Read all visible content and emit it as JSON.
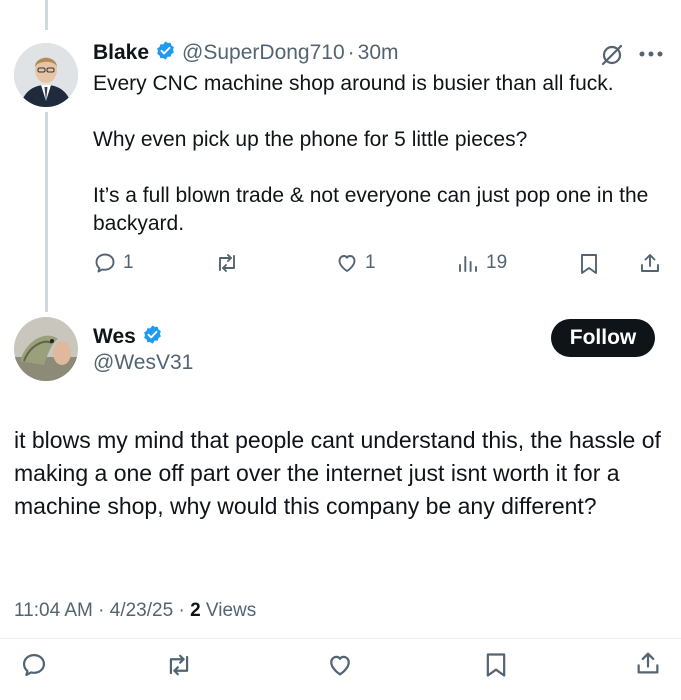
{
  "reply": {
    "name": "Blake",
    "handle": "@SuperDong710",
    "separator": "·",
    "time": "30m",
    "paragraphs": [
      "Every CNC machine shop around is busier than all fuck.",
      "Why even pick up the phone for 5 little pieces?",
      "It’s a full blown trade & not everyone can just pop one in the backyard."
    ],
    "actions": {
      "replies": "1",
      "reposts": "",
      "likes": "1",
      "views": "19"
    }
  },
  "main": {
    "name": "Wes",
    "handle": "@WesV31",
    "follow_label": "Follow",
    "text": "it blows my mind that people cant understand this, the hassle of making a one off part over the internet just isnt worth it for a machine shop, why would this company be any different?",
    "time": "11:04 AM",
    "date": "4/23/25",
    "views_count": "2",
    "views_label": "Views"
  },
  "colors": {
    "verified": "#1d9bf0",
    "muted": "#536471",
    "thread_line": "#cfd9de",
    "text": "#0f1419"
  }
}
